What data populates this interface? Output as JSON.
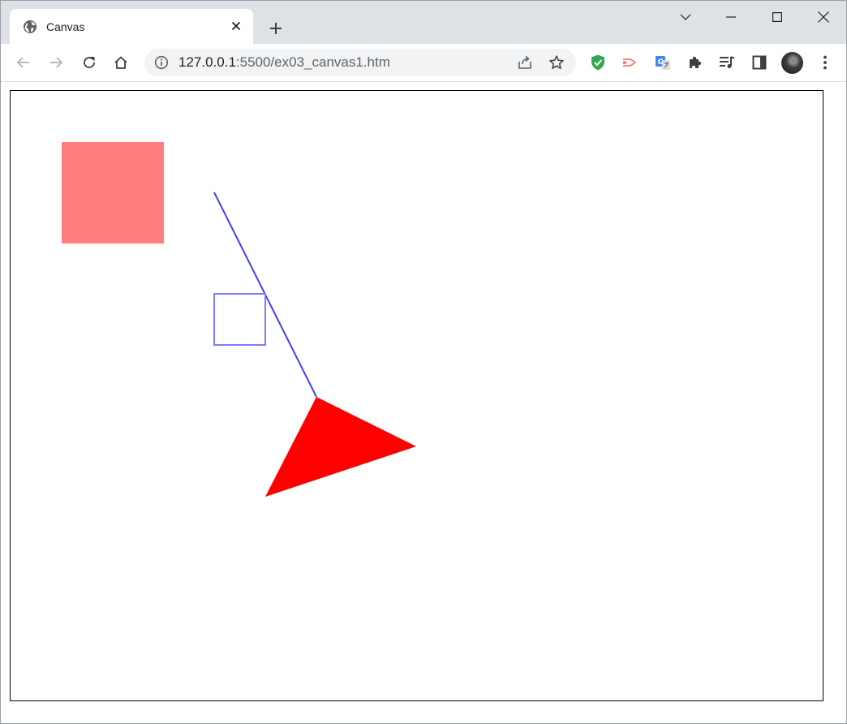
{
  "browser": {
    "tab": {
      "title": "Canvas"
    },
    "address_bar": {
      "host": "127.0.0.1",
      "rest": ":5500/ex03_canvas1.htm"
    },
    "icons": {
      "favicon": "globe-icon",
      "tab_close": "close-icon",
      "new_tab": "plus-icon",
      "tab_search": "chevron-down-icon",
      "minimize": "minimize-icon",
      "maximize": "maximize-icon",
      "close_window": "close-window-icon",
      "back": "back-arrow-icon",
      "forward": "forward-arrow-icon",
      "reload": "reload-icon",
      "home": "home-icon",
      "site_info": "info-icon",
      "share": "share-icon",
      "bookmark": "star-icon",
      "extensions": [
        "shield-check-icon",
        "cast-arrow-icon",
        "translate-icon",
        "puzzle-icon",
        "media-queue-icon",
        "side-panel-icon"
      ],
      "profile": "avatar",
      "menu": "kebab-menu-icon"
    }
  },
  "canvas": {
    "colors": {
      "filled_square": "#ff7f7f",
      "outlined_square": "#7b7bff",
      "line": "#4040ff",
      "triangle": "#ff0000",
      "border": "#000000"
    }
  }
}
